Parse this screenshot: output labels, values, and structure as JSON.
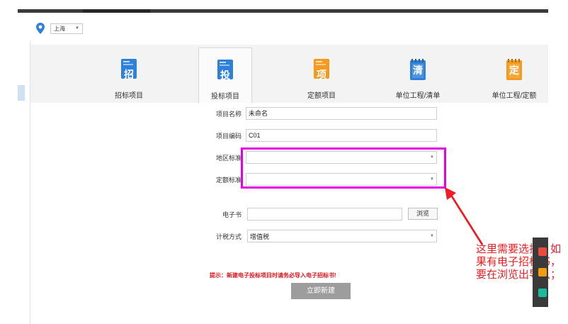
{
  "location": {
    "city": "上海"
  },
  "categories": [
    {
      "glyph": "招",
      "label": "招标项目",
      "color": "#2f80d8",
      "active": false
    },
    {
      "glyph": "投",
      "label": "投标项目",
      "color": "#2f80d8",
      "active": true
    },
    {
      "glyph": "项",
      "label": "定额项目",
      "color": "#f39a1f",
      "active": false
    },
    {
      "glyph": "清",
      "label": "单位工程/清单",
      "color": "#2f80d8",
      "active": false
    },
    {
      "glyph": "定",
      "label": "单位工程/定额",
      "color": "#f39a1f",
      "active": false
    }
  ],
  "form": {
    "project_name": {
      "label": "项目名称",
      "value": "未命名"
    },
    "project_code": {
      "label": "项目编码",
      "value": "C01"
    },
    "region_standard": {
      "label": "地区标准",
      "value": ""
    },
    "quota_standard": {
      "label": "定额标准",
      "value": ""
    },
    "ebook": {
      "label": "电子书",
      "value": "",
      "browse_label": "浏览"
    },
    "tax_method": {
      "label": "计税方式",
      "value": "增值税"
    }
  },
  "hint": "提示：新建电子投标项目时请务必导入电子招标书!",
  "create_button": "立即新建",
  "annotation": "这里需要选择，如果有电子招标书，要在浏览出导入；",
  "colors": {
    "highlight": "#e400e4",
    "annotation": "#ee1c24",
    "hint": "#e0161b"
  }
}
